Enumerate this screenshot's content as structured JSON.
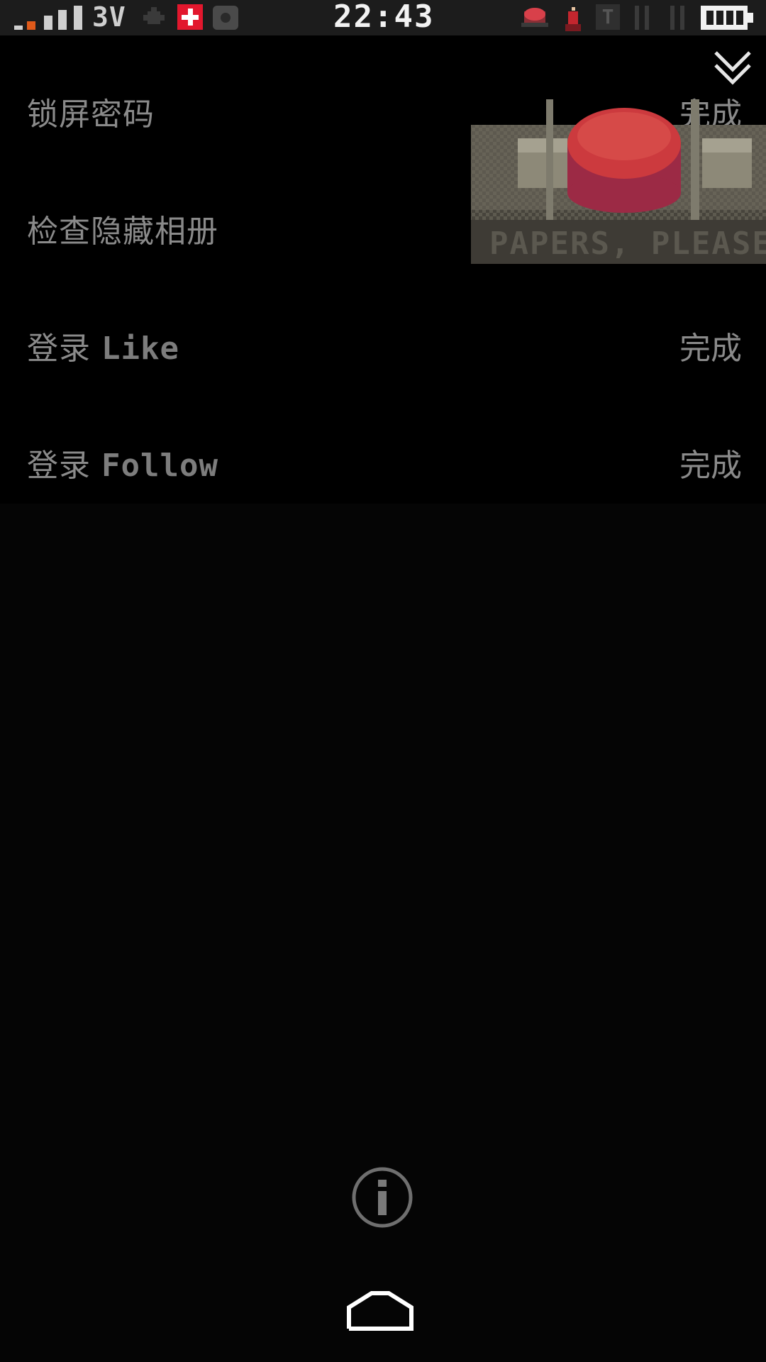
{
  "status_bar": {
    "network_label": "3V",
    "time": "22:43",
    "icons": [
      "signal-icon",
      "puzzle-icon",
      "swiss-flag-icon",
      "camera-icon",
      "stamp-icon",
      "person-icon",
      "t-icon",
      "battery-icon"
    ],
    "accent_colors": {
      "signal_orange": "#e05a1a",
      "swiss_red": "#e2172d",
      "stamp_red": "#d8404a"
    }
  },
  "settings": {
    "items": [
      {
        "label": "锁屏密码",
        "status": "完成"
      },
      {
        "label": "检查隐藏相册",
        "status": ""
      },
      {
        "label_cn": "登录",
        "label_en": "Like",
        "status": "完成"
      },
      {
        "label_cn": "登录",
        "label_en": "Follow",
        "status": "完成"
      }
    ]
  },
  "game_art": {
    "banner_text": "PAPERS, PLEASE",
    "button_color": "#cc3a3e"
  },
  "bottom": {
    "icons": [
      "info-icon",
      "home-icon"
    ]
  }
}
